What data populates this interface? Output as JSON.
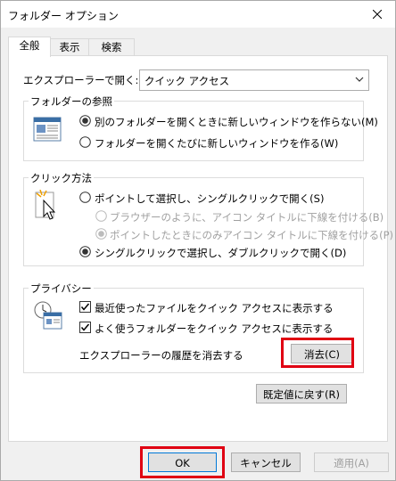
{
  "window": {
    "title": "フォルダー オプション"
  },
  "tabs": [
    {
      "label": "全般"
    },
    {
      "label": "表示"
    },
    {
      "label": "検索"
    }
  ],
  "open_in": {
    "label": "エクスプローラーで開く:",
    "value": "クイック アクセス"
  },
  "browse_folders": {
    "title": "フォルダーの参照",
    "options": [
      {
        "label": "別のフォルダーを開くときに新しいウィンドウを作らない(M)",
        "selected": true
      },
      {
        "label": "フォルダーを開くたびに新しいウィンドウを作る(W)",
        "selected": false
      }
    ]
  },
  "click_method": {
    "title": "クリック方法",
    "options": [
      {
        "label": "ポイントして選択し、シングルクリックで開く(S)",
        "selected": false,
        "enabled": true
      },
      {
        "label": "ブラウザーのように、アイコン タイトルに下線を付ける(B)",
        "selected": false,
        "enabled": false
      },
      {
        "label": "ポイントしたときにのみアイコン タイトルに下線を付ける(P)",
        "selected": true,
        "enabled": false
      },
      {
        "label": "シングルクリックで選択し、ダブルクリックで開く(D)",
        "selected": true,
        "enabled": true
      }
    ]
  },
  "privacy": {
    "title": "プライバシー",
    "checks": [
      {
        "label": "最近使ったファイルをクイック アクセスに表示する",
        "checked": true
      },
      {
        "label": "よく使うフォルダーをクイック アクセスに表示する",
        "checked": true
      }
    ],
    "clear_label": "エクスプローラーの履歴を消去する",
    "clear_button": "消去(C)"
  },
  "restore_defaults": "既定値に戻す(R)",
  "buttons": {
    "ok": "OK",
    "cancel": "キャンセル",
    "apply": "適用(A)"
  },
  "colors": {
    "highlight": "#e00012",
    "accent": "#0078d7"
  }
}
